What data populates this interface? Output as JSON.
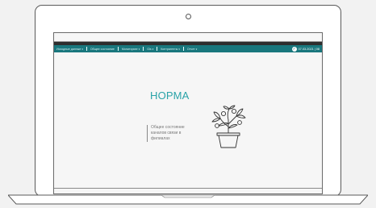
{
  "nav": {
    "items": [
      {
        "label": "Исходные данные",
        "caret": true
      },
      {
        "label": "Общее состояние",
        "caret": false
      },
      {
        "label": "Мониторинг",
        "caret": true
      },
      {
        "label": "Gis",
        "caret": true
      },
      {
        "label": "Контрагенты",
        "caret": true
      },
      {
        "label": "Отчет",
        "caret": true
      }
    ],
    "datetime": "07.03.2021 | 08"
  },
  "status": {
    "title": "НОРМА",
    "description": "Общее состояние каналов связи в филиалах"
  },
  "icons": {
    "status_ok": "checkmark-circle-icon",
    "illustration": "potted-plant-icon"
  },
  "colors": {
    "nav_bg": "#19777d",
    "accent": "#2aa3a8",
    "dark_bar": "#2e2e2e"
  }
}
